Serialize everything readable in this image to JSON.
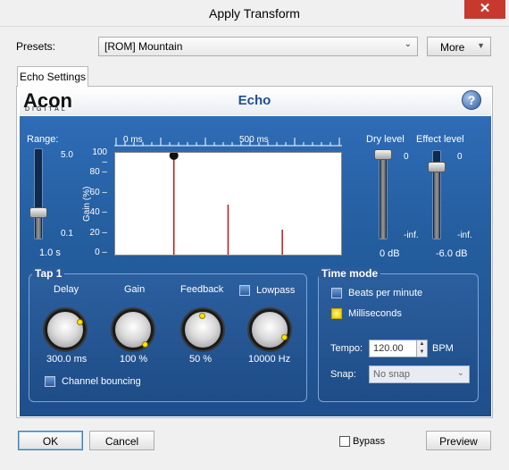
{
  "window": {
    "title": "Apply Transform",
    "close_glyph": "✕"
  },
  "presets": {
    "label": "Presets:",
    "value": "[ROM] Mountain",
    "more_label": "More"
  },
  "tab": {
    "label": "Echo Settings"
  },
  "header": {
    "logo_main": "Acon",
    "logo_sub": "DIGITAL",
    "title": "Echo",
    "help_glyph": "?"
  },
  "range": {
    "label": "Range:",
    "max": "5.0",
    "min": "0.1",
    "value": "1.0 s",
    "level_fraction": 0.27
  },
  "timeline": {
    "start": "0 ms",
    "mid": "500 ms"
  },
  "graph": {
    "y_axis_label": "Gain (%)",
    "y_ticks": [
      "100",
      "80",
      "60",
      "40",
      "20",
      "0"
    ],
    "taps_ms": [
      300,
      600,
      900
    ],
    "taps_gain": [
      100,
      50,
      25
    ]
  },
  "dry": {
    "label": "Dry level",
    "top": "0",
    "bottom": "-inf.",
    "value": "0 dB",
    "level_fraction": 1.0
  },
  "effect": {
    "label": "Effect level",
    "top": "0",
    "bottom": "-inf.",
    "value": "-6.0 dB",
    "level_fraction": 0.85
  },
  "tap": {
    "title": "Tap 1",
    "delay": {
      "label": "Delay",
      "value": "300.0 ms"
    },
    "gain": {
      "label": "Gain",
      "value": "100 %"
    },
    "feedback": {
      "label": "Feedback",
      "value": "50 %"
    },
    "lowpass": {
      "label": "Lowpass",
      "value": "10000 Hz",
      "checked": false
    },
    "channel_bouncing": {
      "label": "Channel bouncing",
      "checked": false
    }
  },
  "time_mode": {
    "title": "Time mode",
    "bpm_option": "Beats per minute",
    "ms_option": "Milliseconds",
    "selected": "Milliseconds",
    "tempo_label": "Tempo:",
    "tempo_value": "120.00",
    "tempo_unit": "BPM",
    "snap_label": "Snap:",
    "snap_value": "No snap"
  },
  "footer": {
    "ok": "OK",
    "cancel": "Cancel",
    "bypass": "Bypass",
    "preview": "Preview",
    "bypass_checked": false
  }
}
